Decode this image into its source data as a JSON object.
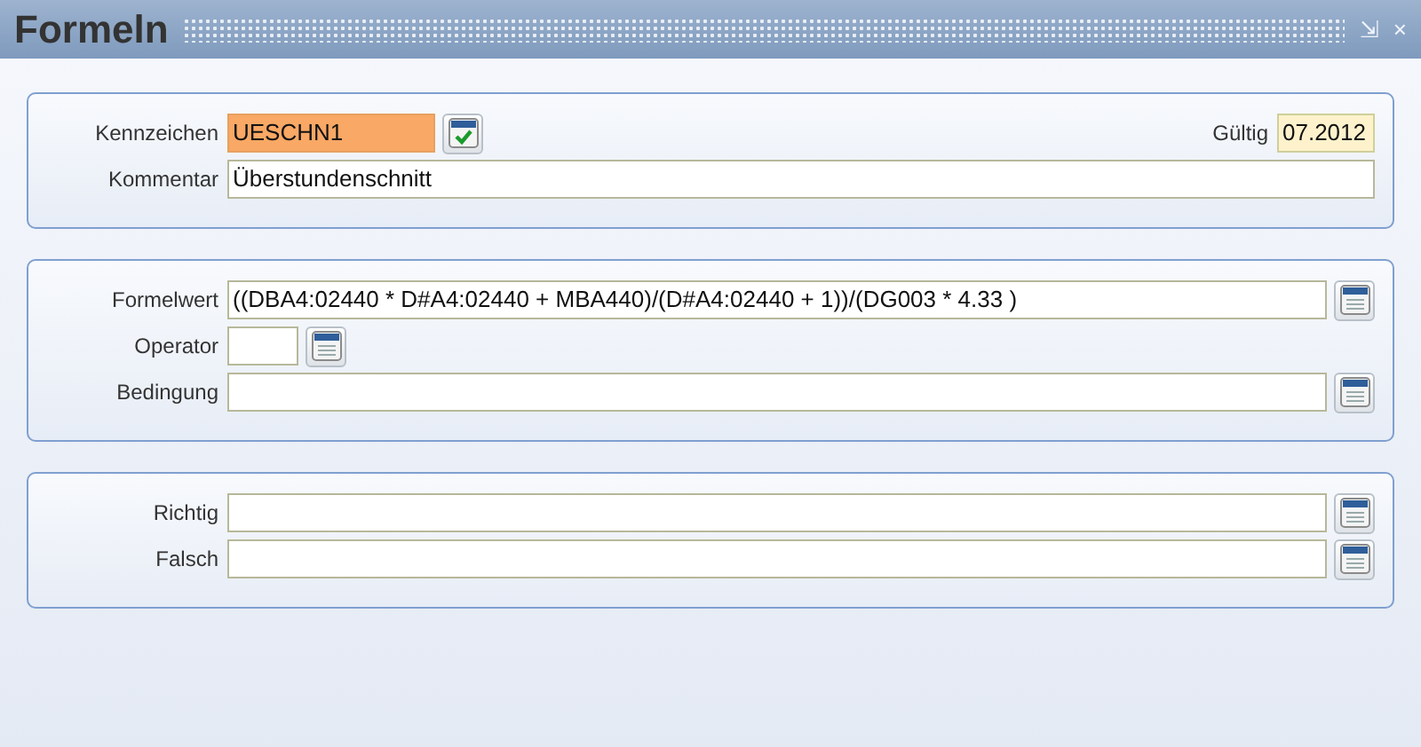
{
  "window": {
    "title": "Formeln",
    "controls": [
      "⇲",
      "×"
    ]
  },
  "sections": [
    {
      "rows": [
        [
          {
            "label": "Kennzeichen",
            "value": "UESCHN1",
            "kind": "code",
            "focused": true,
            "button": {
              "kind": "check"
            }
          },
          {
            "label": "Gültig",
            "value": "07.2012",
            "kind": "date",
            "focused": false
          }
        ],
        [
          {
            "label": "Kommentar",
            "value": "Überstundenschnitt",
            "kind": "full",
            "focused": false
          }
        ]
      ]
    },
    {
      "rows": [
        [
          {
            "label": "Formelwert",
            "value": "((DBA4:02440 * D#A4:02440 + MBA440)/(D#A4:02440 + 1))/(DG003 * 4.33 )",
            "kind": "full",
            "focused": false,
            "button": {
              "kind": "list"
            }
          }
        ],
        [
          {
            "label": "Operator",
            "kind": "operator",
            "focused": false,
            "button": {
              "kind": "list"
            }
          }
        ],
        [
          {
            "label": "Bedingung",
            "kind": "full",
            "focused": false,
            "button": {
              "kind": "list"
            }
          }
        ]
      ]
    },
    {
      "rows": [
        [
          {
            "label": "Richtig",
            "kind": "full",
            "focused": false,
            "button": {
              "kind": "list"
            }
          }
        ],
        [
          {
            "label": "Falsch",
            "kind": "full",
            "focused": false,
            "button": {
              "kind": "list"
            }
          }
        ]
      ]
    }
  ]
}
